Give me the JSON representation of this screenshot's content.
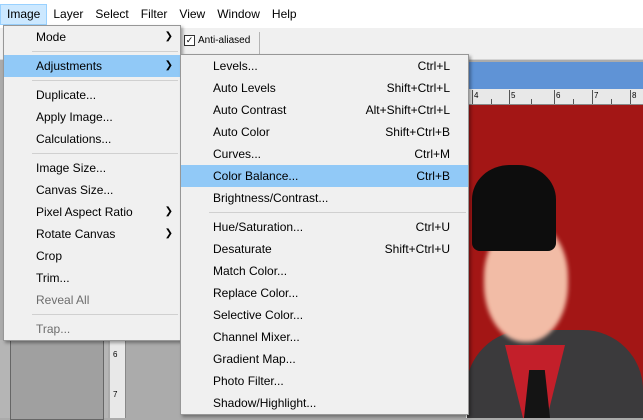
{
  "menubar": {
    "items": [
      "Image",
      "Layer",
      "Select",
      "Filter",
      "View",
      "Window",
      "Help"
    ]
  },
  "options_bar": {
    "anti_aliased_label": "Anti-aliased",
    "checkbox_mark": "✓"
  },
  "rulers": {
    "top_numbers": [
      "4",
      "5",
      "6",
      "7",
      "8"
    ],
    "left_numbers": [
      "6",
      "7"
    ]
  },
  "image_menu": {
    "items": [
      {
        "label": "Mode",
        "submenu": true
      },
      {
        "sep": true
      },
      {
        "label": "Adjustments",
        "submenu": true,
        "highlighted": true
      },
      {
        "sep": true
      },
      {
        "label": "Duplicate..."
      },
      {
        "label": "Apply Image..."
      },
      {
        "label": "Calculations..."
      },
      {
        "sep": true
      },
      {
        "label": "Image Size..."
      },
      {
        "label": "Canvas Size..."
      },
      {
        "label": "Pixel Aspect Ratio",
        "submenu": true
      },
      {
        "label": "Rotate Canvas",
        "submenu": true
      },
      {
        "label": "Crop"
      },
      {
        "label": "Trim..."
      },
      {
        "label": "Reveal All",
        "disabled": true
      },
      {
        "sep": true
      },
      {
        "label": "Trap...",
        "disabled": true
      }
    ]
  },
  "adjustments_menu": {
    "items": [
      {
        "label": "Levels...",
        "shortcut": "Ctrl+L"
      },
      {
        "label": "Auto Levels",
        "shortcut": "Shift+Ctrl+L"
      },
      {
        "label": "Auto Contrast",
        "shortcut": "Alt+Shift+Ctrl+L"
      },
      {
        "label": "Auto Color",
        "shortcut": "Shift+Ctrl+B"
      },
      {
        "label": "Curves...",
        "shortcut": "Ctrl+M"
      },
      {
        "label": "Color Balance...",
        "shortcut": "Ctrl+B",
        "highlighted": true
      },
      {
        "label": "Brightness/Contrast...",
        "shortcut": ""
      },
      {
        "sep": true
      },
      {
        "label": "Hue/Saturation...",
        "shortcut": "Ctrl+U"
      },
      {
        "label": "Desaturate",
        "shortcut": "Shift+Ctrl+U"
      },
      {
        "label": "Match Color...",
        "shortcut": ""
      },
      {
        "label": "Replace Color...",
        "shortcut": ""
      },
      {
        "label": "Selective Color...",
        "shortcut": ""
      },
      {
        "label": "Channel Mixer...",
        "shortcut": ""
      },
      {
        "label": "Gradient Map...",
        "shortcut": ""
      },
      {
        "label": "Photo Filter...",
        "shortcut": ""
      },
      {
        "label": "Shadow/Highlight...",
        "shortcut": ""
      }
    ]
  },
  "colors": {
    "highlight": "#91c9f7",
    "menubar_active": "#cce8ff",
    "photo_background": "#a31615"
  }
}
